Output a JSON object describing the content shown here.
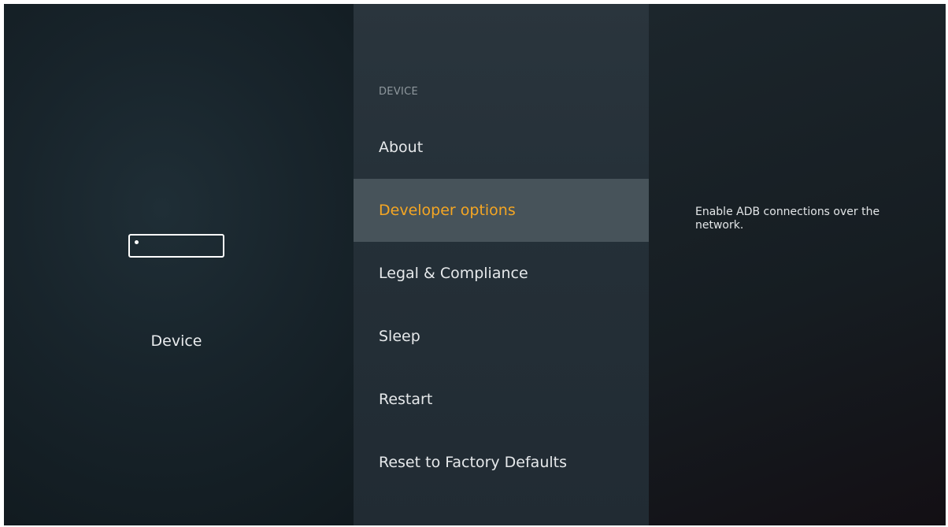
{
  "left_panel": {
    "icon": "device-icon",
    "label": "Device"
  },
  "menu": {
    "header": "DEVICE",
    "items": [
      {
        "label": "About",
        "selected": false
      },
      {
        "label": "Developer options",
        "selected": true
      },
      {
        "label": "Legal & Compliance",
        "selected": false
      },
      {
        "label": "Sleep",
        "selected": false
      },
      {
        "label": "Restart",
        "selected": false
      },
      {
        "label": "Reset to Factory Defaults",
        "selected": false
      }
    ]
  },
  "description": {
    "text": "Enable ADB connections over the network."
  },
  "colors": {
    "selected_text": "#f5a623",
    "selected_background": "#47535a"
  }
}
